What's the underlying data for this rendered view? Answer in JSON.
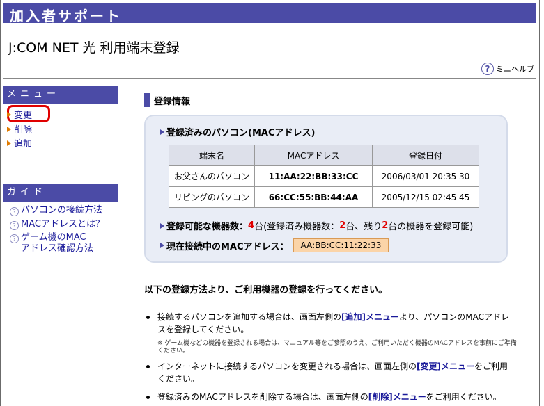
{
  "header": {
    "title": "加入者サポート"
  },
  "page_title": "J:COM NET 光  利用端末登録",
  "mini_help": {
    "label": "ミニヘルプ",
    "icon": "question-circle-icon"
  },
  "sidebar": {
    "menu_title": "メニュー",
    "menu_items": [
      {
        "label": "変更"
      },
      {
        "label": "削除"
      },
      {
        "label": "追加"
      }
    ],
    "guide_title": "ガイド",
    "guide_items": [
      {
        "label": "パソコンの接続方法"
      },
      {
        "label": "MACアドレスとは？"
      },
      {
        "label_line1": "ゲーム機のMAC",
        "label_line2": "アドレス確認方法"
      }
    ]
  },
  "main": {
    "section_title": "登録情報",
    "registered_label": "登録済みのパソコン(MACアドレス)",
    "table": {
      "headers": [
        "端末名",
        "MACアドレス",
        "登録日付"
      ],
      "rows": [
        {
          "name": "お父さんのパソコン",
          "mac": "11:AA:22:BB:33:CC",
          "date": "2006/03/01 20:35 30"
        },
        {
          "name": "リビングのパソコン",
          "mac": "66:CC:55:BB:44:AA",
          "date": "2005/12/15 02:45 45"
        }
      ]
    },
    "device_count": {
      "label": "登録可能な機器数：",
      "total": "4",
      "text1": "台(登録済み機器数：",
      "registered": "2",
      "text2": "台、残り",
      "remaining": "2",
      "text3": "台の機器を登録可能)"
    },
    "current_mac": {
      "label": "現在接続中のMACアドレス：",
      "value": "AA:BB:CC:11:22:33"
    },
    "instruction": "以下の登録方法より、ご利用機器の登録を行ってください。",
    "bullets": {
      "b1_pre": "接続するパソコンを追加する場合は、画面左側の",
      "b1_link": "[追加]メニュー",
      "b1_post": "より、パソコンのMACアドレスを登録してください。",
      "note": "※ ゲーム機などの機器を登録される場合は、マニュアル等をご参照のうえ、ご利用いただく機器のMACアドレスを事前にご準備ください。",
      "b2_pre": "インターネットに接続するパソコンを変更される場合は、画面左側の",
      "b2_link": "[変更]メニュー",
      "b2_post": "をご利用ください。",
      "b3_pre": "登録済みのMACアドレスを削除する場合は、画面左側の",
      "b3_link": "[削除]メニュー",
      "b3_post": "をご利用ください。"
    }
  },
  "colors": {
    "brand": "#4b4ba6",
    "highlight": "#e00000",
    "accent": "#e07b00"
  }
}
